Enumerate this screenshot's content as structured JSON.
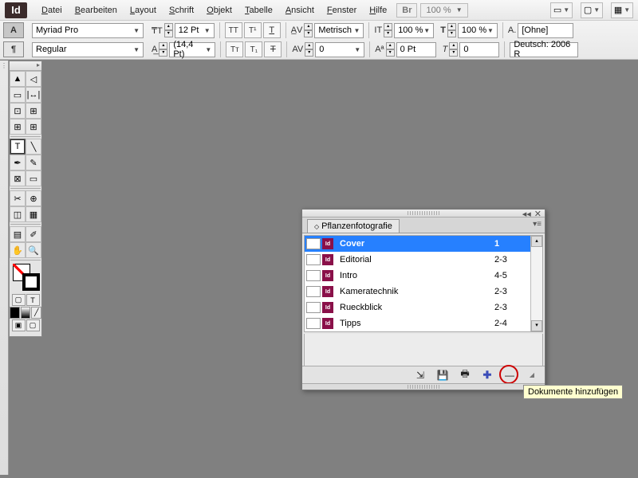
{
  "app": {
    "logo": "Id"
  },
  "menu": {
    "items": [
      "Datei",
      "Bearbeiten",
      "Layout",
      "Schrift",
      "Objekt",
      "Tabelle",
      "Ansicht",
      "Fenster",
      "Hilfe"
    ],
    "bridge": "Br",
    "zoom": "100 %"
  },
  "ctrl": {
    "paragraph_badge": "A",
    "pilcrow": "¶",
    "font": "Myriad Pro",
    "style": "Regular",
    "size": "12 Pt",
    "leading": "(14,4 Pt)",
    "kerning": "Metrisch",
    "tracking": "0",
    "hscale": "100 %",
    "vscale": "100 %",
    "baseline": "0 Pt",
    "skew": "0",
    "charstyle": "[Ohne]",
    "lang": "Deutsch: 2006 R"
  },
  "panel": {
    "tab": "Pflanzenfotografie",
    "rows": [
      {
        "name": "Cover",
        "pages": "1",
        "selected": true
      },
      {
        "name": "Editorial",
        "pages": "2-3",
        "selected": false
      },
      {
        "name": "Intro",
        "pages": "4-5",
        "selected": false
      },
      {
        "name": "Kameratechnik",
        "pages": "2-3",
        "selected": false
      },
      {
        "name": "Rueckblick",
        "pages": "2-3",
        "selected": false
      },
      {
        "name": "Tipps",
        "pages": "2-4",
        "selected": false
      }
    ]
  },
  "tooltip": "Dokumente hinzufügen"
}
